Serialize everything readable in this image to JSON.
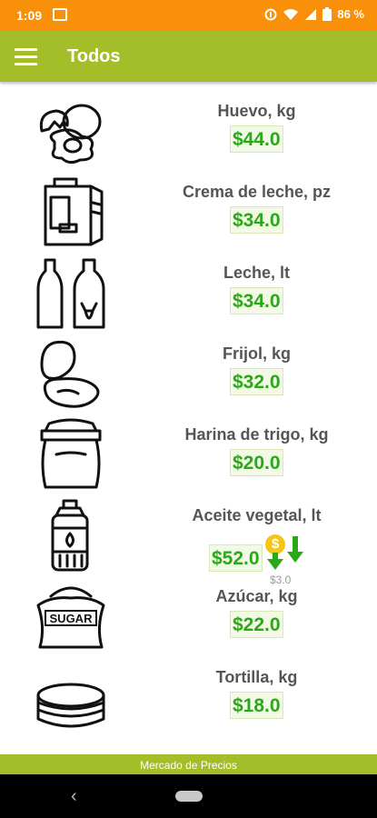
{
  "status": {
    "time": "1:09",
    "battery": "86 %"
  },
  "appbar": {
    "title": "Todos"
  },
  "products": [
    {
      "name": "Huevo, kg",
      "price": "$44.0",
      "icon": "eggs-icon"
    },
    {
      "name": "Crema de leche, pz",
      "price": "$34.0",
      "icon": "cream-carton-icon"
    },
    {
      "name": "Leche, lt",
      "price": "$34.0",
      "icon": "milk-bottles-icon"
    },
    {
      "name": "Frijol, kg",
      "price": "$32.0",
      "icon": "beans-icon"
    },
    {
      "name": "Harina de trigo, kg",
      "price": "$20.0",
      "icon": "flour-sack-icon"
    },
    {
      "name": "Aceite vegetal, lt",
      "price": "$52.0",
      "icon": "oil-bottle-icon",
      "change": {
        "symbol": "$",
        "amount": "$3.0",
        "direction": "down"
      }
    },
    {
      "name": "Azúcar, kg",
      "price": "$22.0",
      "icon": "sugar-sack-icon",
      "icon_label": "SUGAR"
    },
    {
      "name": "Tortilla, kg",
      "price": "$18.0",
      "icon": "tortillas-icon"
    }
  ],
  "footer": {
    "label": "Mercado de Precios"
  },
  "colors": {
    "status_bar": "#f9900a",
    "app_bar": "#a4be2a",
    "price_green": "#2aa81a",
    "coin": "#f5c518"
  }
}
